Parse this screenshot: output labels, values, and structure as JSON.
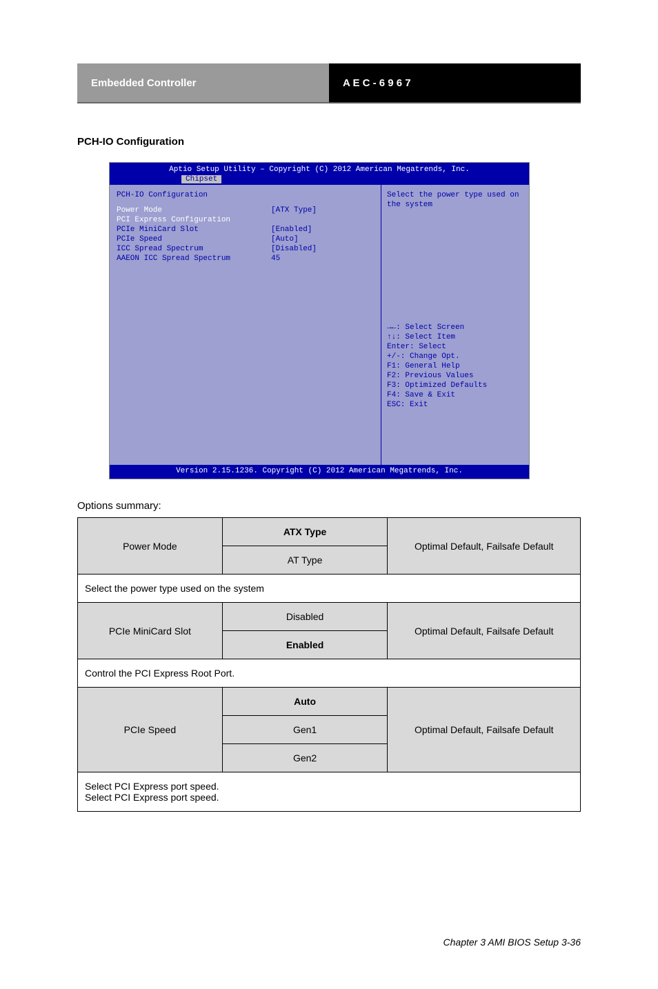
{
  "header": {
    "left": "Embedded Controller",
    "right": "A E C - 6 9 6 7"
  },
  "section_title": "PCH-IO Configuration",
  "bios": {
    "title": "Aptio Setup Utility – Copyright (C) 2012 American Megatrends, Inc.",
    "tab": "Chipset",
    "heading": "PCH-IO Configuration",
    "rows": [
      {
        "label": "Power Mode",
        "white": true,
        "value": "[ATX Type]"
      },
      {
        "label": "",
        "value": ""
      },
      {
        "label": "PCI Express Configuration",
        "white": true,
        "value": ""
      },
      {
        "label": "PCIe MiniCard Slot",
        "value": "[Enabled]"
      },
      {
        "label": "PCIe Speed",
        "value": "[Auto]"
      },
      {
        "label": "",
        "value": ""
      },
      {
        "label": "ICC Spread Spectrum",
        "value": "[Disabled]"
      },
      {
        "label": "AAEON ICC Spread Spectrum",
        "value": "45"
      }
    ],
    "right_top": "Select the power type used on the system",
    "help": [
      "→←: Select Screen",
      "↑↓: Select Item",
      "Enter: Select",
      "+/-: Change Opt.",
      "F1: General Help",
      "F2: Previous Values",
      "F3: Optimized Defaults",
      "F4: Save & Exit",
      "ESC: Exit"
    ],
    "footer": "Version 2.15.1236. Copyright (C) 2012 American Megatrends, Inc."
  },
  "options_label": "Options summary:",
  "table": {
    "rows": [
      {
        "type": "opt",
        "name": "Power Mode",
        "values": [
          "ATX Type",
          "AT Type"
        ],
        "default_index": 0,
        "default_text": "Optimal Default, Failsafe Default",
        "desc": "Select the power type used on the system"
      },
      {
        "type": "opt",
        "name": "PCIe MiniCard Slot",
        "values": [
          "Disabled",
          "Enabled"
        ],
        "default_index": 1,
        "default_text": "Optimal Default, Failsafe Default",
        "desc": "Control the PCI Express Root Port."
      },
      {
        "type": "opt",
        "name": "PCIe Speed",
        "values": [
          "Auto",
          "Gen1",
          "Gen2"
        ],
        "default_index": 0,
        "default_text": "Optimal Default, Failsafe Default",
        "desc": "Select PCI Express port speed.\nSelect PCI Express port speed."
      }
    ]
  },
  "chapter_footer": "Chapter 3 AMI BIOS Setup 3-36"
}
